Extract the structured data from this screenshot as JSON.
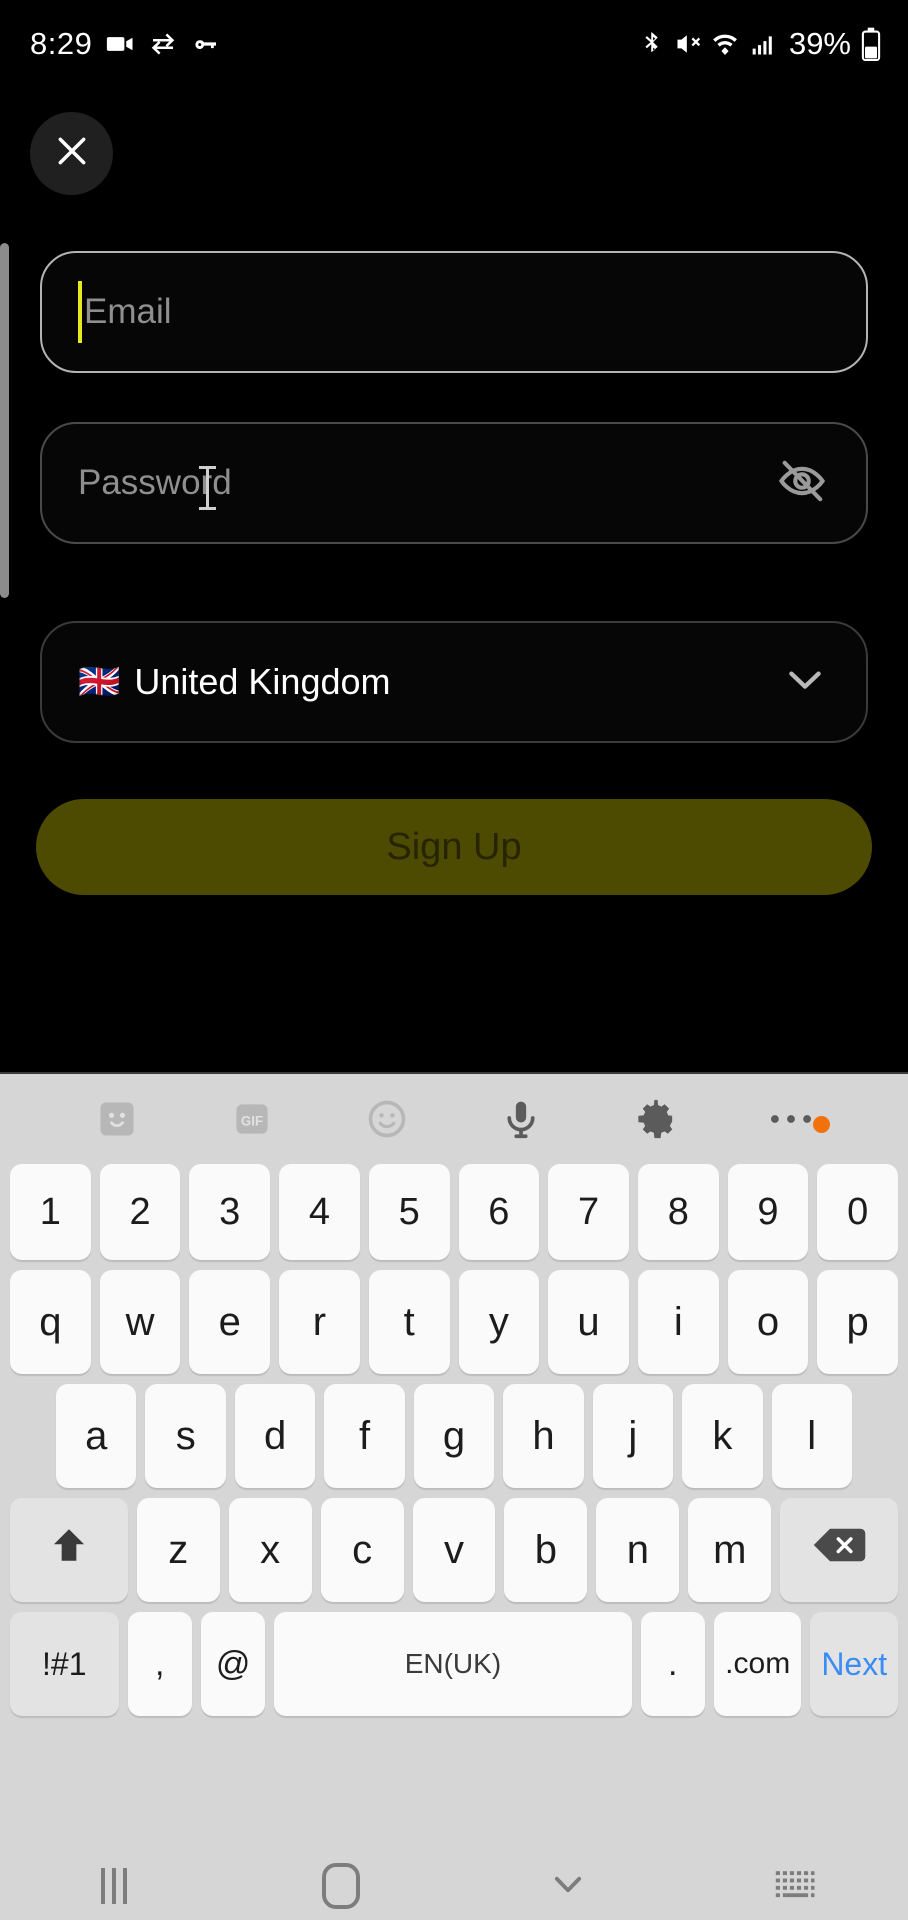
{
  "status_bar": {
    "time": "8:29",
    "battery_percent": "39%",
    "left_icons": [
      "video-camera-icon",
      "vpn-sync-icon",
      "key-icon"
    ],
    "right_icons": [
      "bluetooth-icon",
      "volume-mute-icon",
      "wifi-icon",
      "cellular-signal-icon",
      "battery-icon"
    ]
  },
  "header": {
    "close_icon": "close-icon"
  },
  "form": {
    "email": {
      "placeholder": "Email",
      "value": "",
      "focused": true
    },
    "password": {
      "placeholder": "Password",
      "value": "",
      "visibility_icon": "eye-off-icon"
    },
    "country": {
      "flag": "🇬🇧",
      "label": "United Kingdom",
      "chevron": "chevron-down-icon"
    },
    "submit": {
      "label": "Sign Up",
      "enabled": false,
      "bg_color": "#4d4a02",
      "text_color": "#262401"
    }
  },
  "keyboard": {
    "toolbar": [
      {
        "name": "sticker-icon",
        "faded": true
      },
      {
        "name": "gif-icon",
        "label": "GIF",
        "faded": true
      },
      {
        "name": "emoji-icon",
        "faded": true
      },
      {
        "name": "microphone-icon",
        "faded": false
      },
      {
        "name": "gear-icon",
        "faded": false
      },
      {
        "name": "more-options-icon",
        "faded": false,
        "badge": true
      }
    ],
    "rows": {
      "numbers": [
        "1",
        "2",
        "3",
        "4",
        "5",
        "6",
        "7",
        "8",
        "9",
        "0"
      ],
      "top": [
        "q",
        "w",
        "e",
        "r",
        "t",
        "y",
        "u",
        "i",
        "o",
        "p"
      ],
      "home": [
        "a",
        "s",
        "d",
        "f",
        "g",
        "h",
        "j",
        "k",
        "l"
      ],
      "bottom": [
        "z",
        "x",
        "c",
        "v",
        "b",
        "n",
        "m"
      ]
    },
    "shift_label": "shift-icon",
    "backspace_label": "backspace-icon",
    "symbols_key": "!#1",
    "comma_key": ",",
    "at_key": "@",
    "space_key": "EN(UK)",
    "period_key": ".",
    "dotcom_key": ".com",
    "next_key": "Next",
    "next_color": "#3b8cf5"
  },
  "navbar": {
    "recents": "recents-icon",
    "home": "home-icon",
    "hide_keyboard": "chevron-down-icon",
    "keyboard_switch": "keyboard-icon"
  }
}
